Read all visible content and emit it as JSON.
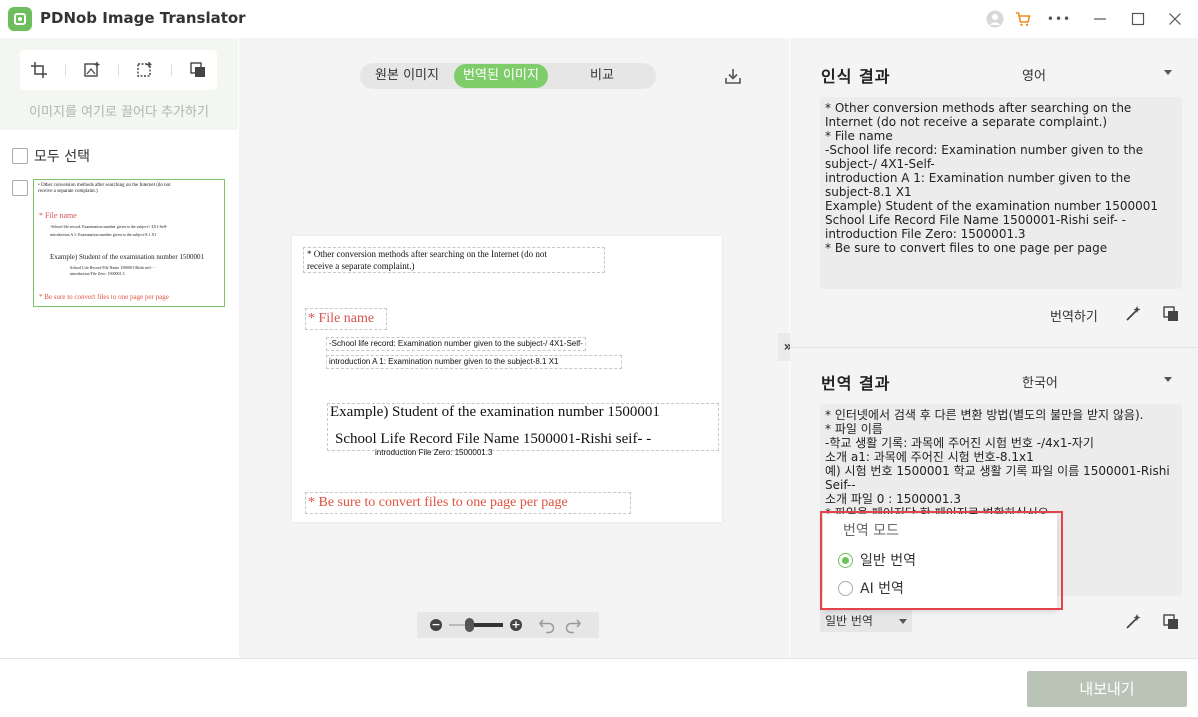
{
  "app": {
    "title": "PDNob Image Translator"
  },
  "window_controls": {
    "more": "•••"
  },
  "left": {
    "drop_hint": "이미지를 여기로 끌어다 추가하기",
    "select_all": "모두 선택",
    "thumbnail_lines": [
      "• Other conversion methods after searching on the Internet (do not",
      "receive a separate complaint.)",
      "* File name",
      "-School life record: Examination number given to the subject-/ 4X1-Self-",
      "introduction A 1: Examination number given to the subject-8.1 X1",
      "Example)  Student of the examination number 1500001",
      "School Life Record File Name  1500001-Rishi seif- -",
      "introduction File Zero: 1500001.3",
      "* Be sure to convert files to one page per page"
    ]
  },
  "center": {
    "tabs": [
      "원본 이미지",
      "번역된 이미지",
      "비교"
    ],
    "active_tab": "번역된 이미지",
    "doc": {
      "line1": "* Other conversion methods after searching on the Internet (do not",
      "line2": "receive a separate complaint.)",
      "file_name": "* File name",
      "school1": "-School life record: Examination number given to the subject-/ 4X1-Self-",
      "school2": "introduction A 1: Examination number given to the subject-8.1 X1",
      "example1": "Example) Student of the examination number 1500001",
      "example2": "School Life Record File Name 1500001-Rishi seif- -",
      "intro_zero": "introduction File Zero: 1500001.3",
      "be_sure": "* Be sure to convert files to one page per page"
    },
    "expand": "»"
  },
  "recognition": {
    "title": "인식 결과",
    "language": "영어",
    "text": "* Other conversion methods after searching on the Internet (do not receive a separate complaint.)\n* File name\n-School life record: Examination number given to the subject-/ 4X1-Self-\nintroduction A 1: Examination number given to the subject-8.1 X1\nExample) Student of the examination number 1500001 School Life Record File Name 1500001-Rishi seif- -\nintroduction File Zero: 1500001.3\n* Be sure to convert files to one page per page",
    "translate_button": "번역하기"
  },
  "translation": {
    "title": "번역 결과",
    "language": "한국어",
    "text": "* 인터넷에서 검색 후 다른 변환 방법(별도의 불만을 받지 않음).\n* 파일 이름\n-학교 생활 기록: 과목에 주어진 시험 번호 -/4x1-자기\n소개 a1: 과목에 주어진 시험 번호-8.1x1\n예) 시험 번호 1500001 학교 생활 기록 파일 이름 1500001-Rishi Seif--\n소개 파일 0 : 1500001.3\n* 파일을 페이지당 한 페이지로 변환하십시오.",
    "mode_selected": "일반 번역"
  },
  "mode_popup": {
    "title": "번역 모드",
    "options": [
      "일반 번역",
      "AI 번역"
    ],
    "selected": "일반 번역"
  },
  "footer": {
    "export": "내보내기"
  },
  "colors": {
    "accent": "#7fcd6a",
    "highlight": "#e4424d",
    "title_red": "#d9534f",
    "export_disabled": "#b9c4b6"
  }
}
